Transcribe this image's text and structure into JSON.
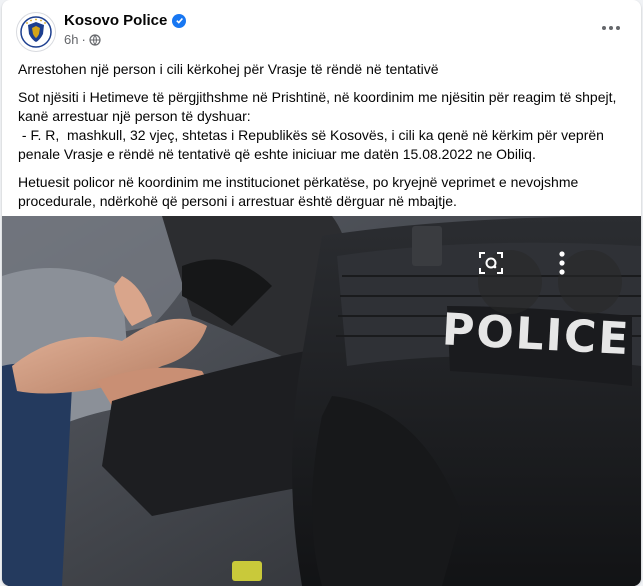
{
  "post": {
    "author": "Kosovo Police",
    "time": "6h",
    "paragraphs": {
      "p1": "Arrestohen një person i cili kërkohej për Vrasje të rëndë në tentativë",
      "p2_l1": "Sot njësiti i Hetimeve të përgjithshme në Prishtinë, në koordinim me njësitin për reagim të shpejt,",
      "p2_l2": "kanë arrestuar një person të dyshuar:",
      "p2_l3": " - F. R,  mashkull, 32 vjeç, shtetas i Republikës së Kosovës, i cili ka qenë në kërkim për veprën",
      "p2_l4": "penale Vrasje e rëndë në tentativë që eshte iniciuar me datën 15.08.2022 ne Obiliq.",
      "p3_l1": "Hetuesit policor në koordinim me institucionet përkatëse, po kryejnë veprimet e nevojshme",
      "p3_l2": "procedurale, ndërkohë që personi i arrestuar është dërguar në mbajtje."
    },
    "photo_badge": "POLICE"
  },
  "icons": {
    "avatar": "police-emblem-icon",
    "verified": "verified-badge-icon",
    "audience": "globe-icon",
    "more": "more-options-icon",
    "lens": "visual-search-icon",
    "photo_more": "vertical-dots-icon"
  },
  "colors": {
    "accent": "#1877f2",
    "secondary_text": "#65676b",
    "card_bg": "#ffffff",
    "page_bg": "#f0f2f5"
  }
}
